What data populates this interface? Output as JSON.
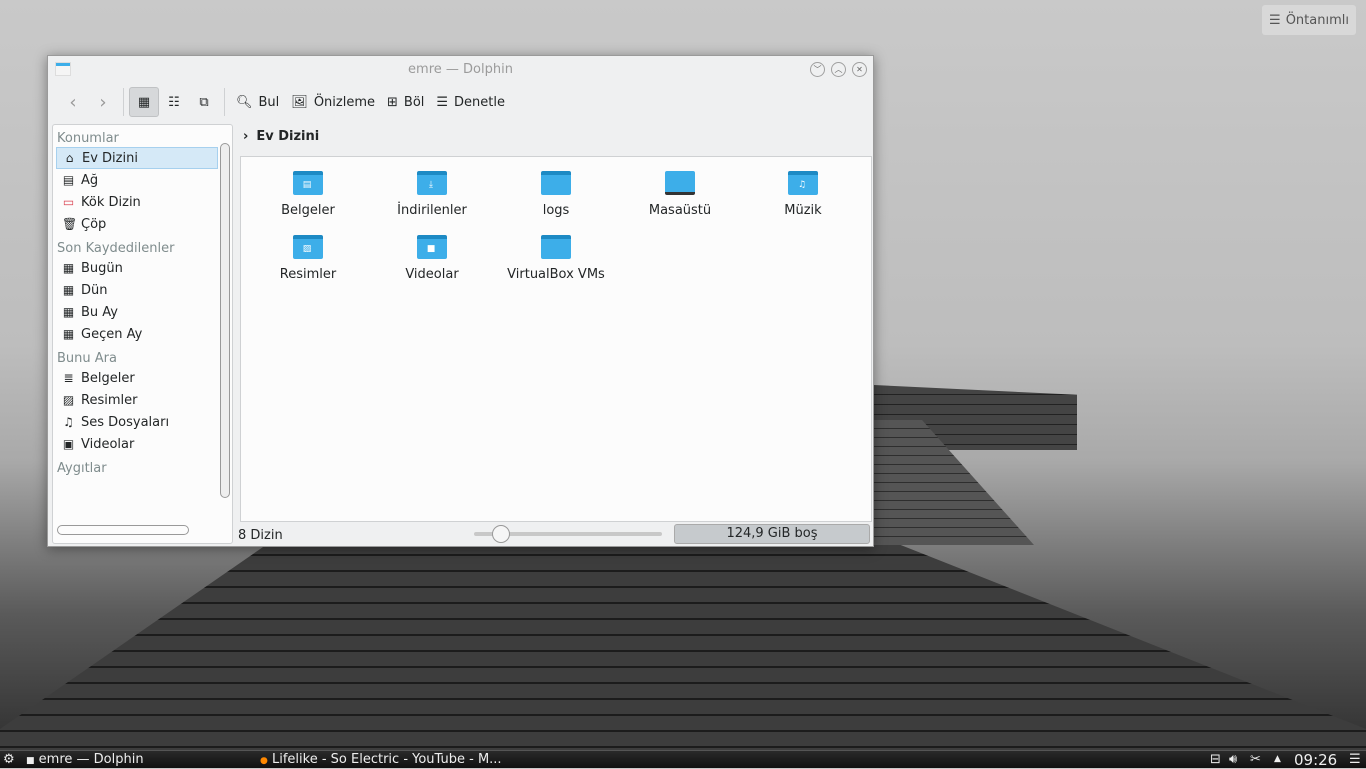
{
  "desktop": {
    "preset_label": "Öntanımlı"
  },
  "window": {
    "title": "emre — Dolphin"
  },
  "toolbar": {
    "find": "Bul",
    "preview": "Önizleme",
    "split": "Böl",
    "control": "Denetle"
  },
  "sidebar": {
    "sections": [
      {
        "title": "Konumlar",
        "items": [
          "Ev Dizini",
          "Ağ",
          "Kök Dizin",
          "Çöp"
        ]
      },
      {
        "title": "Son Kaydedilenler",
        "items": [
          "Bugün",
          "Dün",
          "Bu Ay",
          "Geçen Ay"
        ]
      },
      {
        "title": "Bunu Ara",
        "items": [
          "Belgeler",
          "Resimler",
          "Ses Dosyaları",
          "Videolar"
        ]
      },
      {
        "title": "Aygıtlar",
        "items": []
      }
    ]
  },
  "breadcrumb": "Ev Dizini",
  "files": [
    "Belgeler",
    "İndirilenler",
    "logs",
    "Masaüstü",
    "Müzik",
    "Resimler",
    "Videolar",
    "VirtualBox VMs"
  ],
  "status": {
    "count": "8 Dizin",
    "free": "124,9 GiB boş",
    "zoom_fraction": 0.1,
    "used_fraction": 0.03
  },
  "taskbar": {
    "tasks": [
      "emre — Dolphin",
      "Lifelike - So Electric - YouTube - M..."
    ],
    "clock": "09:26"
  }
}
